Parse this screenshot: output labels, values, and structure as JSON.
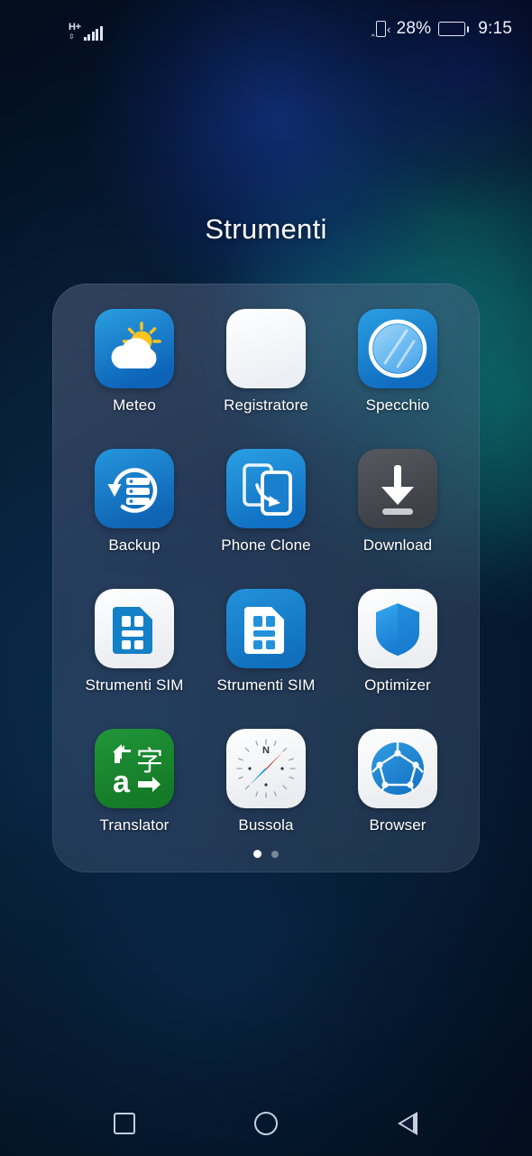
{
  "statusbar": {
    "network_type": "H+",
    "signal_icon": "signal-bars-icon",
    "vibrate_icon": "vibrate-icon",
    "battery_percent": "28%",
    "battery_level": 28,
    "battery_icon": "battery-icon",
    "clock": "9:15"
  },
  "folder": {
    "title": "Strumenti",
    "apps": [
      {
        "label": "Meteo",
        "icon": "weather-icon"
      },
      {
        "label": "Registratore",
        "icon": "recorder-icon"
      },
      {
        "label": "Specchio",
        "icon": "mirror-icon"
      },
      {
        "label": "Backup",
        "icon": "backup-icon"
      },
      {
        "label": "Phone Clone",
        "icon": "phone-clone-icon"
      },
      {
        "label": "Download",
        "icon": "download-icon"
      },
      {
        "label": "Strumenti SIM",
        "icon": "sim-toolkit-white-icon"
      },
      {
        "label": "Strumenti SIM",
        "icon": "sim-toolkit-blue-icon"
      },
      {
        "label": "Optimizer",
        "icon": "shield-icon"
      },
      {
        "label": "Translator",
        "icon": "translator-icon"
      },
      {
        "label": "Bussola",
        "icon": "compass-icon"
      },
      {
        "label": "Browser",
        "icon": "globe-icon"
      }
    ],
    "pages": {
      "count": 2,
      "active": 1
    }
  },
  "navbar": {
    "recents_icon": "square-recents-icon",
    "home_icon": "circle-home-icon",
    "back_icon": "triangle-back-icon"
  },
  "colors": {
    "accent_blue": "#1a8fd8",
    "icon_blue": "#1380c8",
    "translator_green": "#1d8a2f",
    "download_gray": "#4a4d52",
    "text_white": "#ffffff",
    "status_text": "#e8eef7",
    "nav_icon": "#c4cfdf"
  }
}
